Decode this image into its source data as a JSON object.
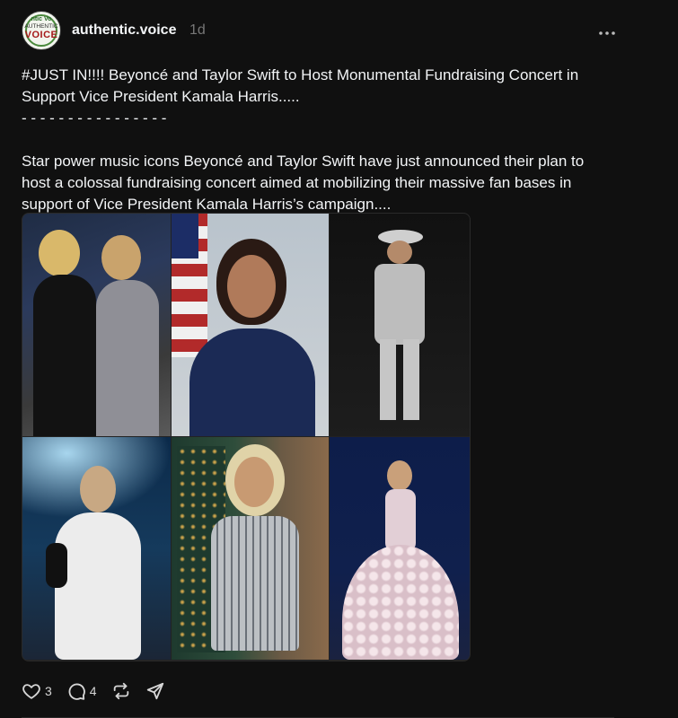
{
  "post": {
    "username": "authentic.voice",
    "timestamp": "1d",
    "avatar": {
      "line1": "ntic Vo",
      "line2": "AUTHENTIC",
      "line3": "VOICE"
    },
    "headline": "#JUST IN!!!! Beyoncé and Taylor Swift to Host Monumental Fundraising Concert in Support Vice President Kamala Harris.....",
    "separator": "- - - - - - - - - - - - - - - -",
    "body": "Star power music icons Beyoncé and Taylor Swift have just announced their plan to host a colossal fundraising concert aimed at mobilizing their massive fan bases in support of Vice President Kamala Harris’s campaign....",
    "images": [
      {
        "name": "photo-two-singers-red-carpet"
      },
      {
        "name": "photo-portrait-with-flag"
      },
      {
        "name": "photo-silver-outfit-cowboy-hat"
      },
      {
        "name": "photo-performer-white-dress-stage"
      },
      {
        "name": "photo-plaid-blazer-christmas-tree"
      },
      {
        "name": "photo-performer-floral-gown"
      }
    ]
  },
  "actions": {
    "likes": "3",
    "replies": "4"
  },
  "colors": {
    "background": "#101010",
    "text": "#f3f5f7",
    "muted": "#777777"
  }
}
